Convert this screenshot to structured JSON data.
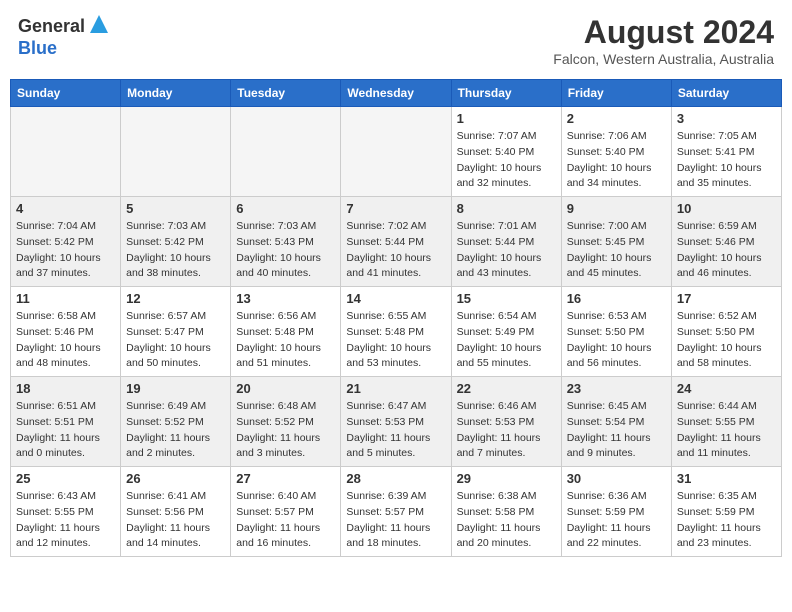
{
  "header": {
    "logo_general": "General",
    "logo_blue": "Blue",
    "month_title": "August 2024",
    "location": "Falcon, Western Australia, Australia"
  },
  "days_of_week": [
    "Sunday",
    "Monday",
    "Tuesday",
    "Wednesday",
    "Thursday",
    "Friday",
    "Saturday"
  ],
  "weeks": [
    {
      "bg": "white",
      "days": [
        {
          "num": "",
          "sunrise": "",
          "sunset": "",
          "daylight": "",
          "empty": true
        },
        {
          "num": "",
          "sunrise": "",
          "sunset": "",
          "daylight": "",
          "empty": true
        },
        {
          "num": "",
          "sunrise": "",
          "sunset": "",
          "daylight": "",
          "empty": true
        },
        {
          "num": "",
          "sunrise": "",
          "sunset": "",
          "daylight": "",
          "empty": true
        },
        {
          "num": "1",
          "sunrise": "7:07 AM",
          "sunset": "5:40 PM",
          "daylight": "10 hours and 32 minutes.",
          "empty": false
        },
        {
          "num": "2",
          "sunrise": "7:06 AM",
          "sunset": "5:40 PM",
          "daylight": "10 hours and 34 minutes.",
          "empty": false
        },
        {
          "num": "3",
          "sunrise": "7:05 AM",
          "sunset": "5:41 PM",
          "daylight": "10 hours and 35 minutes.",
          "empty": false
        }
      ]
    },
    {
      "bg": "gray",
      "days": [
        {
          "num": "4",
          "sunrise": "7:04 AM",
          "sunset": "5:42 PM",
          "daylight": "10 hours and 37 minutes.",
          "empty": false
        },
        {
          "num": "5",
          "sunrise": "7:03 AM",
          "sunset": "5:42 PM",
          "daylight": "10 hours and 38 minutes.",
          "empty": false
        },
        {
          "num": "6",
          "sunrise": "7:03 AM",
          "sunset": "5:43 PM",
          "daylight": "10 hours and 40 minutes.",
          "empty": false
        },
        {
          "num": "7",
          "sunrise": "7:02 AM",
          "sunset": "5:44 PM",
          "daylight": "10 hours and 41 minutes.",
          "empty": false
        },
        {
          "num": "8",
          "sunrise": "7:01 AM",
          "sunset": "5:44 PM",
          "daylight": "10 hours and 43 minutes.",
          "empty": false
        },
        {
          "num": "9",
          "sunrise": "7:00 AM",
          "sunset": "5:45 PM",
          "daylight": "10 hours and 45 minutes.",
          "empty": false
        },
        {
          "num": "10",
          "sunrise": "6:59 AM",
          "sunset": "5:46 PM",
          "daylight": "10 hours and 46 minutes.",
          "empty": false
        }
      ]
    },
    {
      "bg": "white",
      "days": [
        {
          "num": "11",
          "sunrise": "6:58 AM",
          "sunset": "5:46 PM",
          "daylight": "10 hours and 48 minutes.",
          "empty": false
        },
        {
          "num": "12",
          "sunrise": "6:57 AM",
          "sunset": "5:47 PM",
          "daylight": "10 hours and 50 minutes.",
          "empty": false
        },
        {
          "num": "13",
          "sunrise": "6:56 AM",
          "sunset": "5:48 PM",
          "daylight": "10 hours and 51 minutes.",
          "empty": false
        },
        {
          "num": "14",
          "sunrise": "6:55 AM",
          "sunset": "5:48 PM",
          "daylight": "10 hours and 53 minutes.",
          "empty": false
        },
        {
          "num": "15",
          "sunrise": "6:54 AM",
          "sunset": "5:49 PM",
          "daylight": "10 hours and 55 minutes.",
          "empty": false
        },
        {
          "num": "16",
          "sunrise": "6:53 AM",
          "sunset": "5:50 PM",
          "daylight": "10 hours and 56 minutes.",
          "empty": false
        },
        {
          "num": "17",
          "sunrise": "6:52 AM",
          "sunset": "5:50 PM",
          "daylight": "10 hours and 58 minutes.",
          "empty": false
        }
      ]
    },
    {
      "bg": "gray",
      "days": [
        {
          "num": "18",
          "sunrise": "6:51 AM",
          "sunset": "5:51 PM",
          "daylight": "11 hours and 0 minutes.",
          "empty": false
        },
        {
          "num": "19",
          "sunrise": "6:49 AM",
          "sunset": "5:52 PM",
          "daylight": "11 hours and 2 minutes.",
          "empty": false
        },
        {
          "num": "20",
          "sunrise": "6:48 AM",
          "sunset": "5:52 PM",
          "daylight": "11 hours and 3 minutes.",
          "empty": false
        },
        {
          "num": "21",
          "sunrise": "6:47 AM",
          "sunset": "5:53 PM",
          "daylight": "11 hours and 5 minutes.",
          "empty": false
        },
        {
          "num": "22",
          "sunrise": "6:46 AM",
          "sunset": "5:53 PM",
          "daylight": "11 hours and 7 minutes.",
          "empty": false
        },
        {
          "num": "23",
          "sunrise": "6:45 AM",
          "sunset": "5:54 PM",
          "daylight": "11 hours and 9 minutes.",
          "empty": false
        },
        {
          "num": "24",
          "sunrise": "6:44 AM",
          "sunset": "5:55 PM",
          "daylight": "11 hours and 11 minutes.",
          "empty": false
        }
      ]
    },
    {
      "bg": "white",
      "days": [
        {
          "num": "25",
          "sunrise": "6:43 AM",
          "sunset": "5:55 PM",
          "daylight": "11 hours and 12 minutes.",
          "empty": false
        },
        {
          "num": "26",
          "sunrise": "6:41 AM",
          "sunset": "5:56 PM",
          "daylight": "11 hours and 14 minutes.",
          "empty": false
        },
        {
          "num": "27",
          "sunrise": "6:40 AM",
          "sunset": "5:57 PM",
          "daylight": "11 hours and 16 minutes.",
          "empty": false
        },
        {
          "num": "28",
          "sunrise": "6:39 AM",
          "sunset": "5:57 PM",
          "daylight": "11 hours and 18 minutes.",
          "empty": false
        },
        {
          "num": "29",
          "sunrise": "6:38 AM",
          "sunset": "5:58 PM",
          "daylight": "11 hours and 20 minutes.",
          "empty": false
        },
        {
          "num": "30",
          "sunrise": "6:36 AM",
          "sunset": "5:59 PM",
          "daylight": "11 hours and 22 minutes.",
          "empty": false
        },
        {
          "num": "31",
          "sunrise": "6:35 AM",
          "sunset": "5:59 PM",
          "daylight": "11 hours and 23 minutes.",
          "empty": false
        }
      ]
    }
  ],
  "labels": {
    "sunrise": "Sunrise:",
    "sunset": "Sunset:",
    "daylight": "Daylight hours"
  }
}
